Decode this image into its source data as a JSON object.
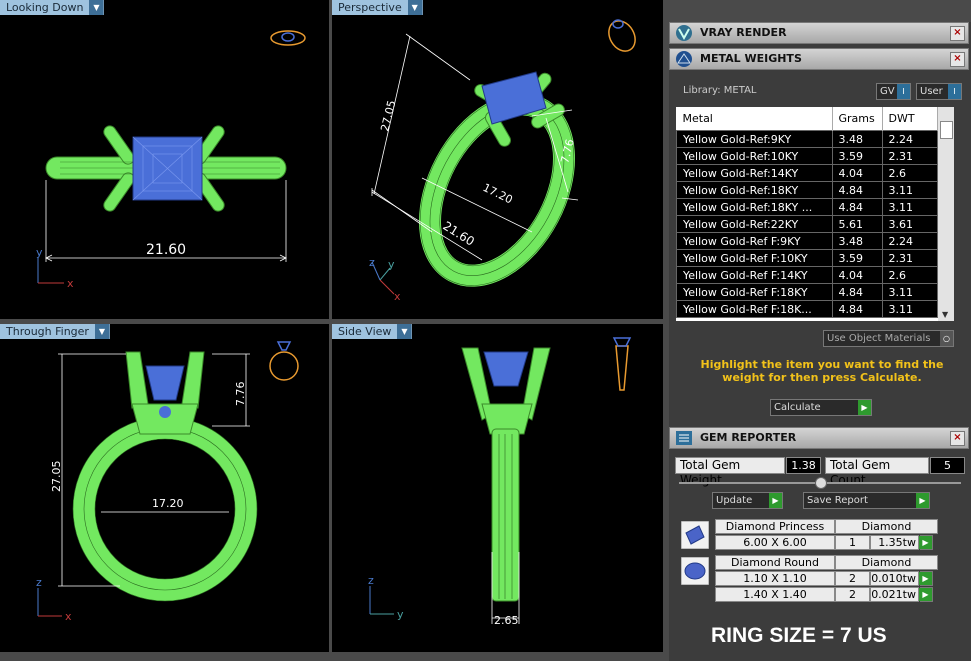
{
  "viewports": {
    "top_left": {
      "label": "Looking Down",
      "dim": "21.60",
      "axis_a": "y",
      "axis_b": "x"
    },
    "top_right": {
      "label": "Perspective",
      "dim_a": "27.05",
      "dim_b": "7.76",
      "dim_c": "17.20",
      "dim_d": "21.60",
      "axis_a": "z",
      "axis_b": "y",
      "axis_c": "x"
    },
    "bottom_left": {
      "label": "Through Finger",
      "dim_a": "27.05",
      "dim_b": "7.76",
      "dim_c": "17.20",
      "axis_a": "z",
      "axis_b": "x"
    },
    "bottom_right": {
      "label": "Side View",
      "dim": "2.65",
      "axis_a": "z",
      "axis_b": "y"
    }
  },
  "vray": {
    "title": "VRAY RENDER"
  },
  "metal": {
    "title": "METAL WEIGHTS",
    "library_label": "Library: METAL",
    "gv": "GV",
    "user": "User",
    "columns": [
      "Metal",
      "Grams",
      "DWT"
    ],
    "rows": [
      [
        "Yellow Gold-Ref:9KY",
        "3.48",
        "2.24"
      ],
      [
        "Yellow Gold-Ref:10KY",
        "3.59",
        "2.31"
      ],
      [
        "Yellow Gold-Ref:14KY",
        "4.04",
        "2.6"
      ],
      [
        "Yellow Gold-Ref:18KY",
        "4.84",
        "3.11"
      ],
      [
        "Yellow Gold-Ref:18KY ...",
        "4.84",
        "3.11"
      ],
      [
        "Yellow Gold-Ref:22KY",
        "5.61",
        "3.61"
      ],
      [
        "Yellow Gold-Ref F:9KY",
        "3.48",
        "2.24"
      ],
      [
        "Yellow Gold-Ref F:10KY",
        "3.59",
        "2.31"
      ],
      [
        "Yellow Gold-Ref F:14KY",
        "4.04",
        "2.6"
      ],
      [
        "Yellow Gold-Ref F:18KY",
        "4.84",
        "3.11"
      ],
      [
        "Yellow Gold-Ref F:18K...",
        "4.84",
        "3.11"
      ]
    ],
    "use_obj": "Use Object Materials",
    "hint": "Highlight the item you want to find the weight for then press Calculate.",
    "calc": "Calculate"
  },
  "gem": {
    "title": "GEM REPORTER",
    "total_weight_label": "Total Gem Weight",
    "total_weight": "1.38",
    "total_count_label": "Total Gem Count",
    "total_count": "5",
    "update": "Update",
    "save": "Save Report",
    "groups": [
      {
        "name": "Diamond Princess",
        "type": "Diamond",
        "rows": [
          [
            "6.00 X 6.00",
            "1",
            "1.35tw"
          ]
        ]
      },
      {
        "name": "Diamond Round",
        "type": "Diamond",
        "rows": [
          [
            "1.10 X 1.10",
            "2",
            "0.010tw"
          ],
          [
            "1.40 X 1.40",
            "2",
            "0.021tw"
          ]
        ]
      }
    ]
  },
  "ring_size": "RING SIZE = 7 US"
}
